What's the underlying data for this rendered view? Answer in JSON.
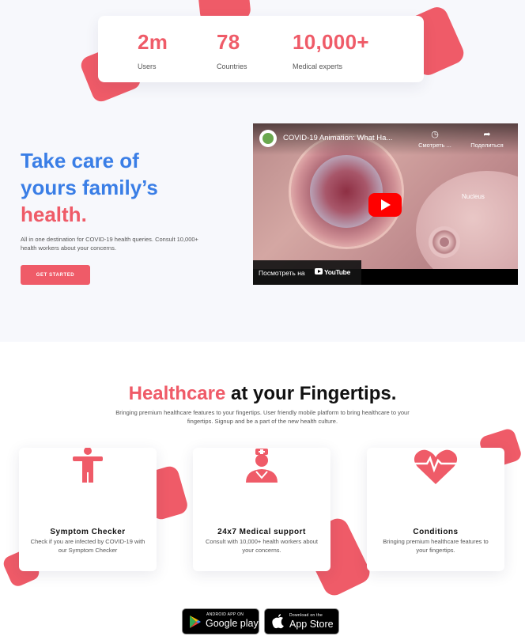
{
  "stats": [
    {
      "value": "2m",
      "label": "Users"
    },
    {
      "value": "78",
      "label": "Countries"
    },
    {
      "value": "10,000+",
      "label": "Medical experts"
    }
  ],
  "hero": {
    "title_line1": "Take care of",
    "title_line2": "yours family’s",
    "title_line3": "health.",
    "description": "All in one destination for COVID-19 health queries. Consult 10,000+ health workers about your concerns.",
    "cta_label": "GET STARTED"
  },
  "video": {
    "title": "COVID-19 Animation: What Ha...",
    "watch_later_label": "Смотреть ...",
    "share_label": "Поделиться",
    "scene_label": "Nucleus",
    "watch_on_label": "Посмотреть на",
    "platform": "YouTube"
  },
  "features": {
    "title_accent": "Healthcare",
    "title_rest": " at your Fingertips.",
    "subtitle": "Bringing premium healthcare features to your fingertips. User friendly mobile platform to bring healthcare to your fingertips. Signup and be a part of the new health culture.",
    "cards": [
      {
        "icon": "person-icon",
        "title": "Symptom Checker",
        "description": "Check if you are infected by COVID-19 with our Symptom Checker"
      },
      {
        "icon": "doctor-icon",
        "title": "24x7 Medical support",
        "description": "Consult with 10,000+ health workers about your concerns."
      },
      {
        "icon": "heartbeat-icon",
        "title": "Conditions",
        "description": "Bringing premium healthcare features to your fingertips."
      }
    ]
  },
  "stores": {
    "google_small": "ANDROID APP ON",
    "google_big": "Google play",
    "apple_small": "Download on the",
    "apple_big": "App Store"
  },
  "colors": {
    "accent": "#ef5b68",
    "blue": "#3a7ee6",
    "hero_bg": "#f7f8fc"
  }
}
